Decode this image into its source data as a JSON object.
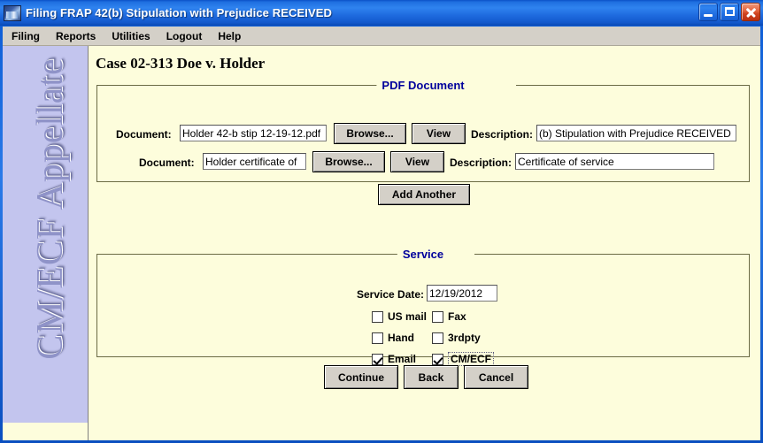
{
  "window": {
    "title": "Filing FRAP 42(b) Stipulation with Prejudice RECEIVED",
    "icon": "app-icon",
    "controls": {
      "minimize": "minimize-icon",
      "maximize": "maximize-icon",
      "close": "close-icon"
    }
  },
  "menubar": {
    "items": [
      {
        "label": "Filing"
      },
      {
        "label": "Reports"
      },
      {
        "label": "Utilities"
      },
      {
        "label": "Logout"
      },
      {
        "label": "Help"
      }
    ]
  },
  "sidebar": {
    "brand": "CM/ECF Appellate"
  },
  "main": {
    "case_title": "Case 02-313 Doe v. Holder",
    "pdf_section": {
      "legend": "PDF Document",
      "rows": [
        {
          "document_label": "Document:",
          "document_value": "Holder 42-b stip 12-19-12.pdf",
          "browse_label": "Browse...",
          "view_label": "View",
          "description_label": "Description:",
          "description_value": "(b) Stipulation with Prejudice RECEIVED"
        },
        {
          "document_label": "Document:",
          "document_value": "Holder certificate of",
          "browse_label": "Browse...",
          "view_label": "View",
          "description_label": "Description:",
          "description_value": "Certificate of service"
        }
      ],
      "add_another_label": "Add Another"
    },
    "service_section": {
      "legend": "Service",
      "service_date_label": "Service Date:",
      "service_date_value": "12/19/2012",
      "checkboxes": [
        {
          "label": "US mail",
          "checked": false,
          "focused": false
        },
        {
          "label": "Fax",
          "checked": false,
          "focused": false
        },
        {
          "label": "Hand",
          "checked": false,
          "focused": false
        },
        {
          "label": "3rdpty",
          "checked": false,
          "focused": false
        },
        {
          "label": "Email",
          "checked": true,
          "focused": false
        },
        {
          "label": "CM/ECF",
          "checked": true,
          "focused": true
        }
      ]
    },
    "actions": {
      "continue_label": "Continue",
      "back_label": "Back",
      "cancel_label": "Cancel"
    }
  },
  "colors": {
    "titlebar_blue": "#1f6ce0",
    "legend_blue": "#00009c",
    "page_background": "#fdfddc",
    "sidebar_background": "#c3c5ee",
    "menubar_gray": "#d4d0c8",
    "button_face": "#d4d0c8",
    "fieldset_border": "#6b6b45"
  }
}
